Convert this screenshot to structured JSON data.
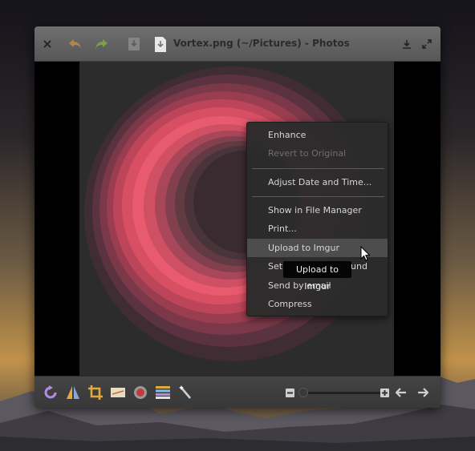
{
  "window": {
    "title": "Vortex.png (~/Pictures) - Photos"
  },
  "toolbar_top": {
    "close_icon": "close-icon",
    "undo_icon": "undo-icon",
    "redo_icon": "redo-icon",
    "download_icon": "download-icon",
    "file_icon": "file-icon",
    "export_icon": "export-icon",
    "fullscreen_icon": "fullscreen-icon"
  },
  "context_menu": {
    "items": [
      {
        "label": "Enhance",
        "enabled": true
      },
      {
        "label": "Revert to Original",
        "enabled": false
      },
      {
        "label": "Adjust Date and Time...",
        "enabled": true
      },
      {
        "label": "Show in File Manager",
        "enabled": true
      },
      {
        "label": "Print...",
        "enabled": true
      },
      {
        "label": "Upload to Imgur",
        "enabled": true,
        "highlighted": true
      },
      {
        "label": "Set",
        "label_tail": "und",
        "enabled": true
      },
      {
        "label": "Send by email",
        "enabled": true
      },
      {
        "label": "Compress",
        "enabled": true
      }
    ]
  },
  "tooltip": {
    "text": "Upload to Imgur"
  },
  "toolbar_bottom": {
    "tools": [
      "rotate-icon",
      "flip-icon",
      "crop-icon",
      "straighten-icon",
      "redeye-icon",
      "adjust-icon",
      "enhance-icon"
    ],
    "zoom_out_icon": "zoom-out-icon",
    "zoom_in_icon": "zoom-in-icon",
    "zoom_level": 0.0,
    "prev_icon": "arrow-left-icon",
    "next_icon": "arrow-right-icon"
  },
  "colors": {
    "accent": "#e85a6e",
    "vortex_dark": "#3a2b30"
  }
}
